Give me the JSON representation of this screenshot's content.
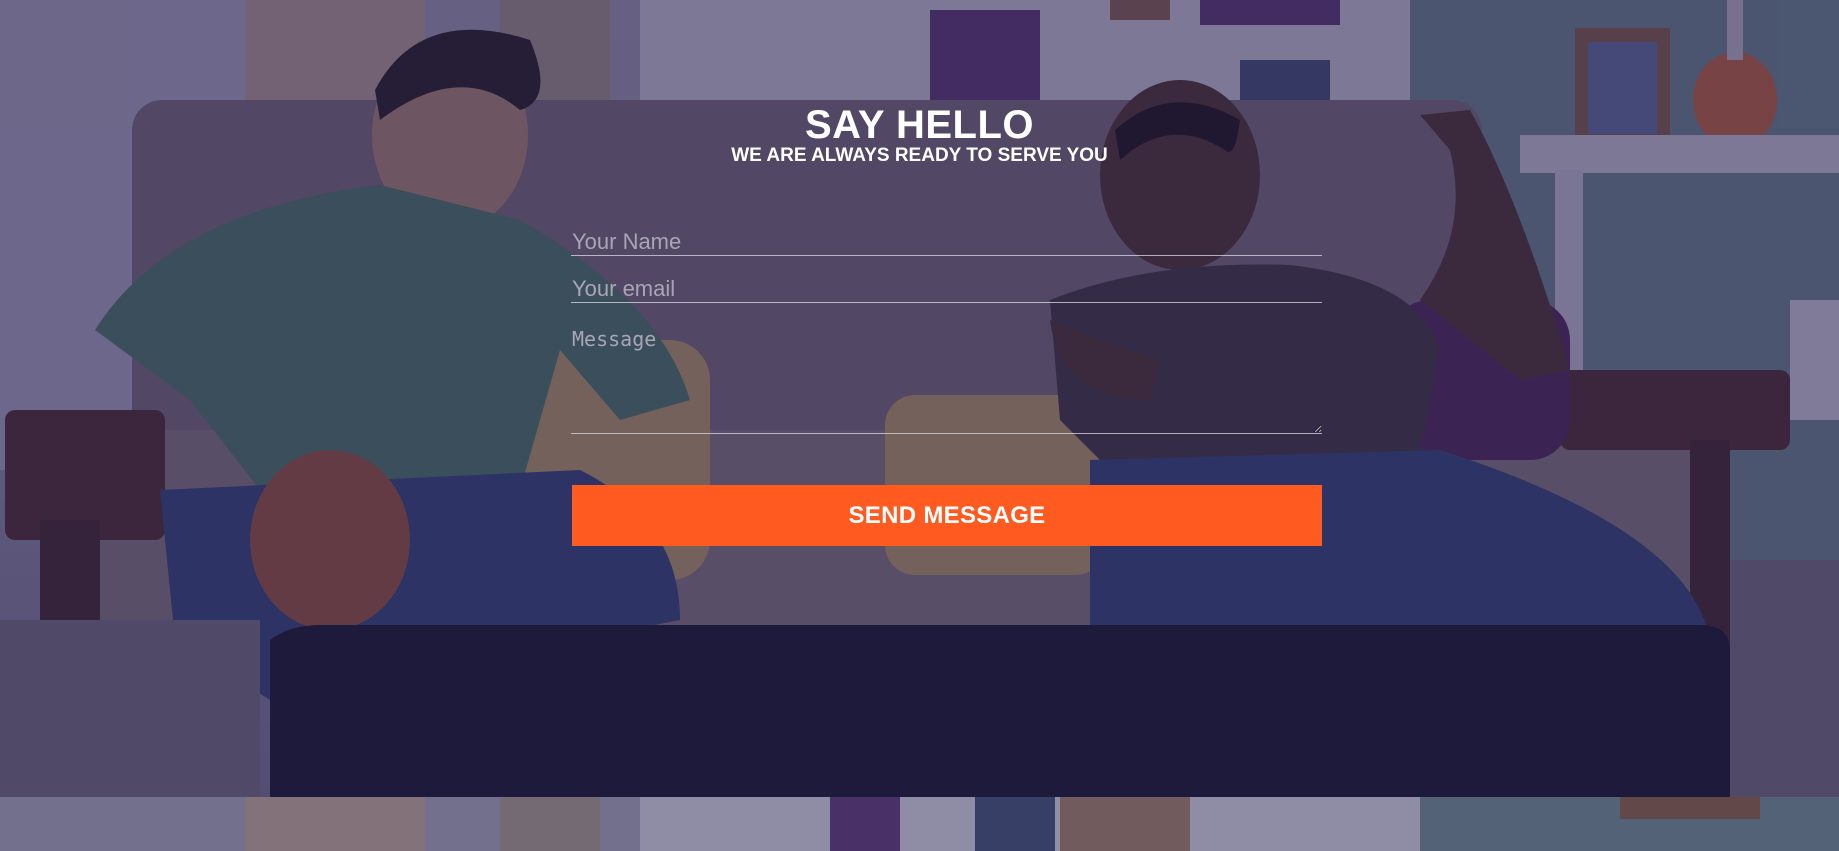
{
  "contact": {
    "title": "SAY HELLO",
    "subtitle": "WE ARE ALWAYS READY TO SERVE YOU",
    "name_placeholder": "Your Name",
    "email_placeholder": "Your email",
    "message_placeholder": "Message",
    "send_label": "SEND MESSAGE"
  },
  "colors": {
    "overlay": "#221e4e",
    "accent": "#ff5a1f",
    "text": "#ffffff"
  }
}
